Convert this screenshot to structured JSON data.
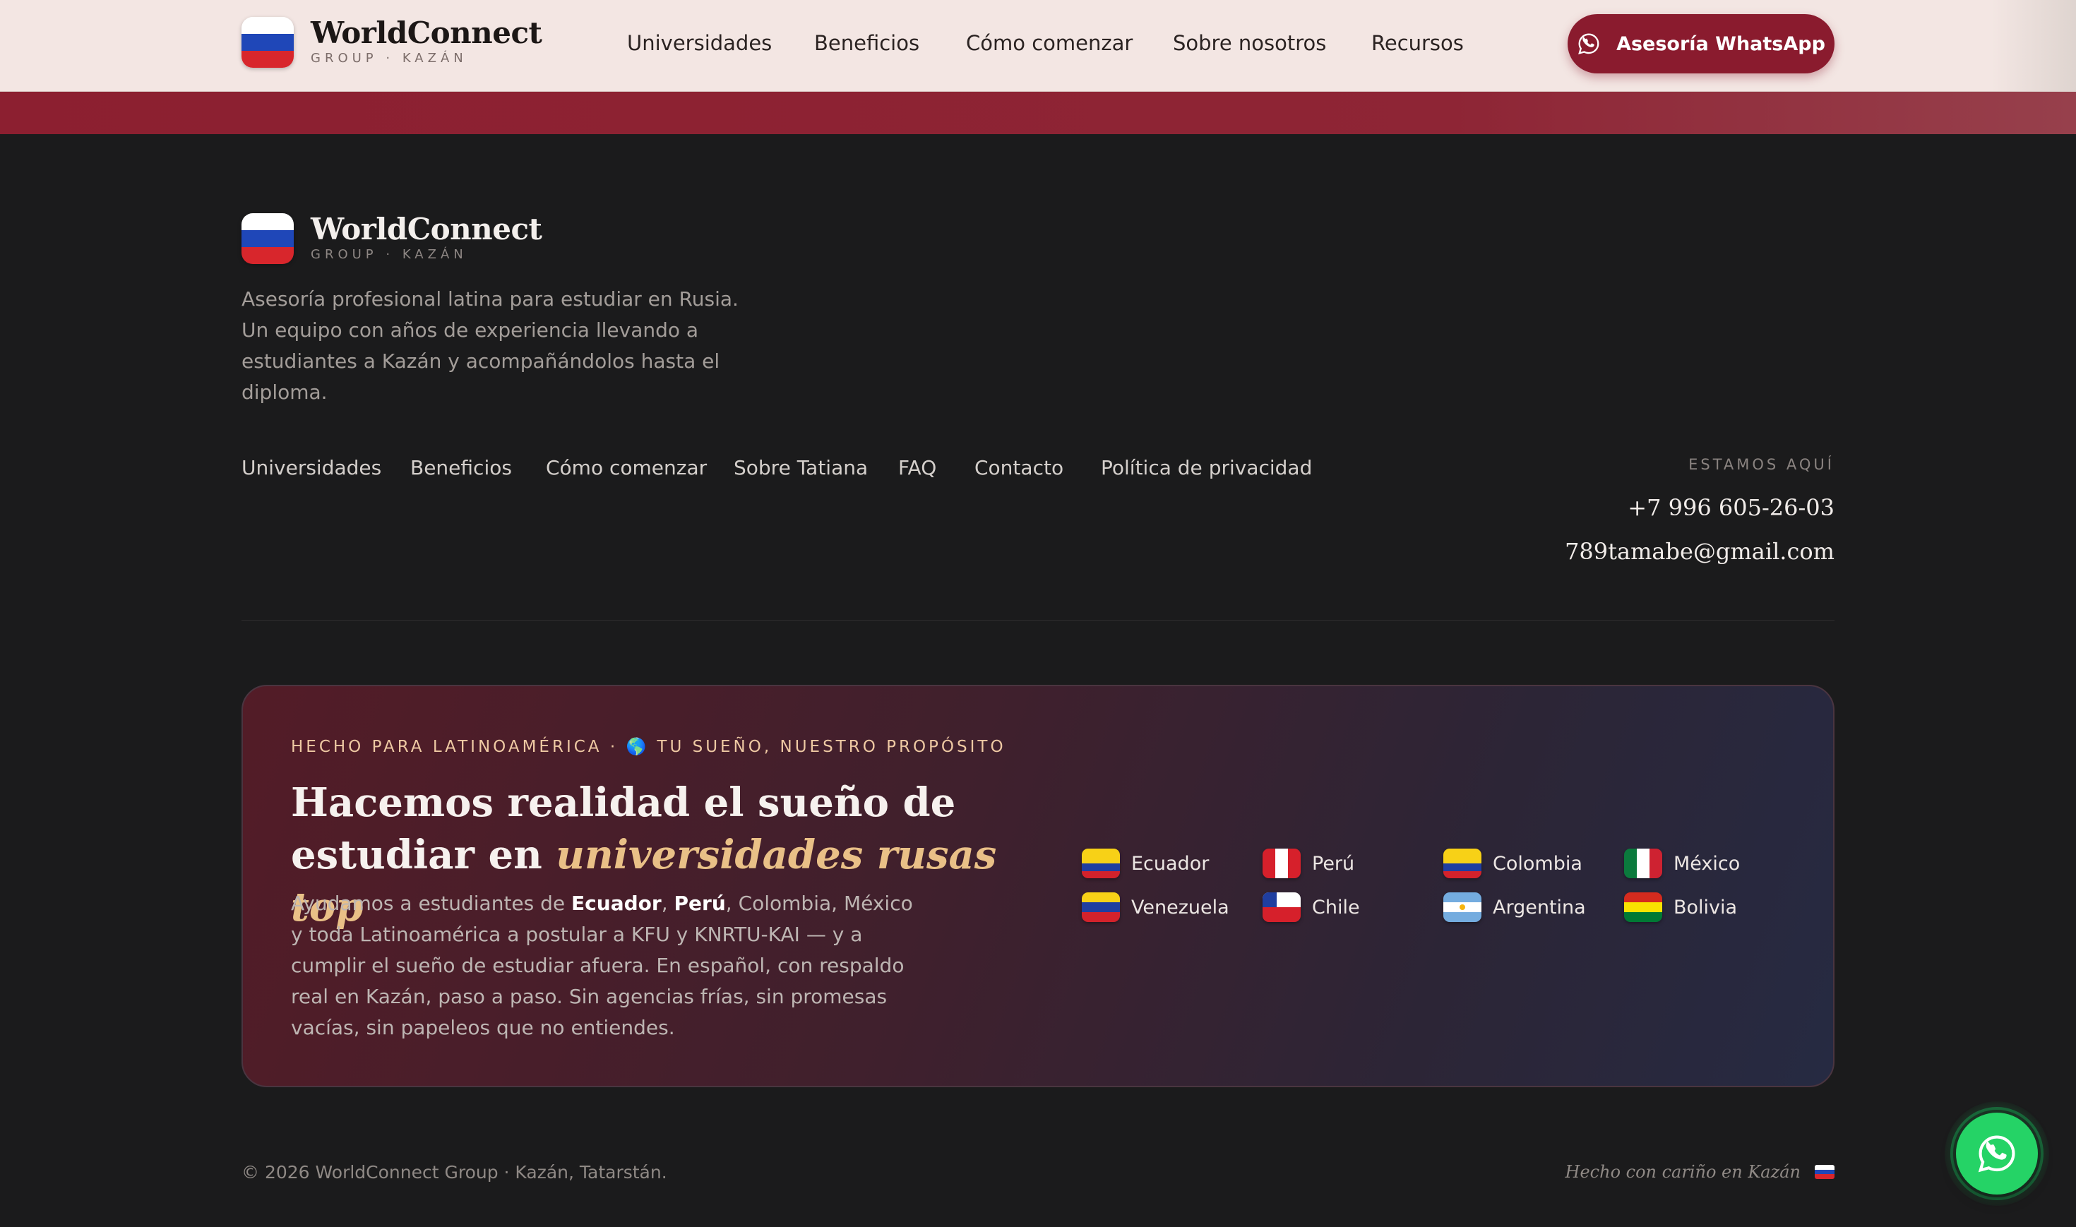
{
  "header": {
    "brand_name": "WorldConnect",
    "brand_sub": "GROUP · KAZÁN",
    "nav": [
      "Universidades",
      "Beneficios",
      "Cómo comenzar",
      "Sobre nosotros",
      "Recursos"
    ],
    "cta_label": "Asesoría WhatsApp"
  },
  "footer": {
    "brand_name": "WorldConnect",
    "brand_sub": "GROUP · KAZÁN",
    "about": "Asesoría profesional latina para estudiar en Rusia. Un equipo con años de experiencia llevando a estudiantes a Kazán y acompañándolos hasta el diploma.",
    "links": [
      "Universidades",
      "Beneficios",
      "Cómo comenzar",
      "Sobre Tatiana",
      "FAQ",
      "Contacto",
      "Política de privacidad"
    ],
    "contact": {
      "label": "ESTAMOS AQUÍ",
      "phone": "+7 996 605-26-03",
      "email": "789tamabe@gmail.com"
    }
  },
  "card": {
    "eyebrow": "HECHO PARA LATINOAMÉRICA · 🌎 TU SUEÑO, NUESTRO PROPÓSITO",
    "headline_1": "Hacemos realidad el sueño de",
    "headline_2": "estudiar en ",
    "headline_accent": "universidades rusas top",
    "body": {
      "pre": "Ayudamos a estudiantes de ",
      "b1": "Ecuador",
      "sep": ", ",
      "b2": "Perú",
      "rest": ", Colombia, México y toda Latinoamérica a postular a KFU y KNRTU-KAI — y a cumplir el sueño de estudiar afuera. En español, con respaldo real en Kazán, paso a paso. Sin agencias frías, sin promesas vacías, sin papeleos que no entiendes."
    },
    "countries": [
      "Ecuador",
      "Perú",
      "Colombia",
      "México",
      "Venezuela",
      "Chile",
      "Argentina",
      "Bolivia"
    ]
  },
  "bottom": {
    "copyright": "© 2026 WorldConnect Group · Kazán, Tatarstán.",
    "made": "Hecho con cariño en Kazán"
  },
  "icons": {
    "whatsapp": "whatsapp-icon",
    "logo": "russia-flag-icon"
  },
  "colors": {
    "brand": "#8a1b2e",
    "accent_gold": "#e9c087",
    "whatsapp_green": "#25d366"
  }
}
